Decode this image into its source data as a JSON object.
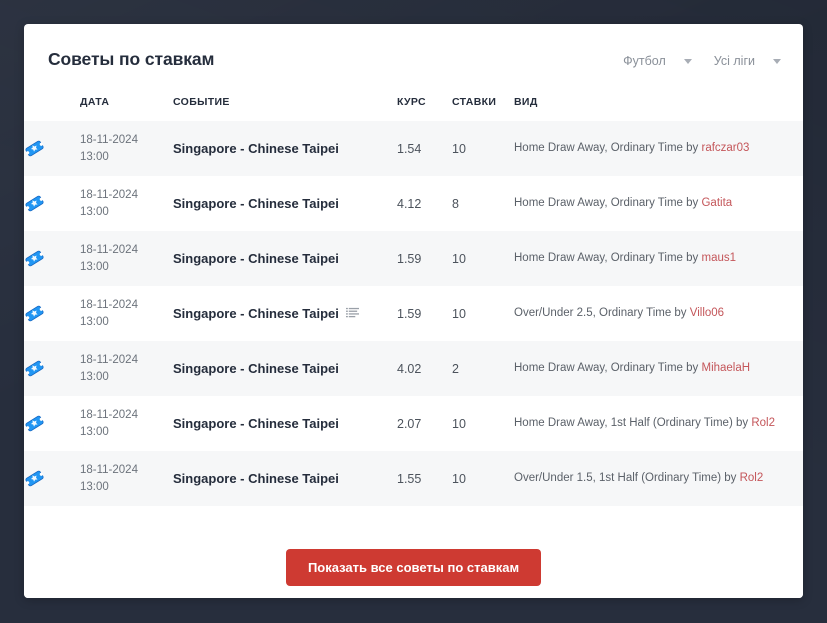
{
  "card": {
    "title": "Советы по ставкам",
    "filters": [
      {
        "label": "Футбол",
        "icon": "chevron-down-icon"
      },
      {
        "label": "Усі ліги",
        "icon": "chevron-down-icon"
      }
    ]
  },
  "table": {
    "headers": {
      "icon": "",
      "date": "ДАТА",
      "event": "СОБЫТИЕ",
      "odds": "КУРС",
      "stakes": "СТАВКИ",
      "kind": "ВИД"
    },
    "rows": [
      {
        "icon": "ticket-icon",
        "date": "18-11-2024",
        "time": "13:00",
        "event": "Singapore - Chinese Taipei",
        "has_note_icon": false,
        "odds": "1.54",
        "stakes": "10",
        "kind_text": "Home Draw Away, Ordinary Time by",
        "user": "rafczar03"
      },
      {
        "icon": "ticket-icon",
        "date": "18-11-2024",
        "time": "13:00",
        "event": "Singapore - Chinese Taipei",
        "has_note_icon": false,
        "odds": "4.12",
        "stakes": "8",
        "kind_text": "Home Draw Away, Ordinary Time by",
        "user": "Gatita"
      },
      {
        "icon": "ticket-icon",
        "date": "18-11-2024",
        "time": "13:00",
        "event": "Singapore - Chinese Taipei",
        "has_note_icon": false,
        "odds": "1.59",
        "stakes": "10",
        "kind_text": "Home Draw Away, Ordinary Time by",
        "user": "maus1"
      },
      {
        "icon": "ticket-icon",
        "date": "18-11-2024",
        "time": "13:00",
        "event": "Singapore - Chinese Taipei",
        "has_note_icon": true,
        "odds": "1.59",
        "stakes": "10",
        "kind_text": "Over/Under 2.5, Ordinary Time by",
        "user": "Villo06"
      },
      {
        "icon": "ticket-icon",
        "date": "18-11-2024",
        "time": "13:00",
        "event": "Singapore - Chinese Taipei",
        "has_note_icon": false,
        "odds": "4.02",
        "stakes": "2",
        "kind_text": "Home Draw Away, Ordinary Time by",
        "user": "MihaelaH"
      },
      {
        "icon": "ticket-icon",
        "date": "18-11-2024",
        "time": "13:00",
        "event": "Singapore - Chinese Taipei",
        "has_note_icon": false,
        "odds": "2.07",
        "stakes": "10",
        "kind_text": "Home Draw Away, 1st Half (Ordinary Time) by",
        "user": "Rol2"
      },
      {
        "icon": "ticket-icon",
        "date": "18-11-2024",
        "time": "13:00",
        "event": "Singapore - Chinese Taipei",
        "has_note_icon": false,
        "odds": "1.55",
        "stakes": "10",
        "kind_text": "Over/Under 1.5, 1st Half (Ordinary Time) by",
        "user": "Rol2"
      }
    ]
  },
  "footer": {
    "cta_label": "Показать все советы по ставкам"
  },
  "colors": {
    "page_background": "#272e3d",
    "card_background": "#ffffff",
    "row_stripe": "#f6f7f8",
    "accent_red": "#ce3a32",
    "username": "#c4565a",
    "ticket_blue": "#2196f3",
    "heading_text": "#252d3c",
    "muted_text": "#8a9099"
  }
}
